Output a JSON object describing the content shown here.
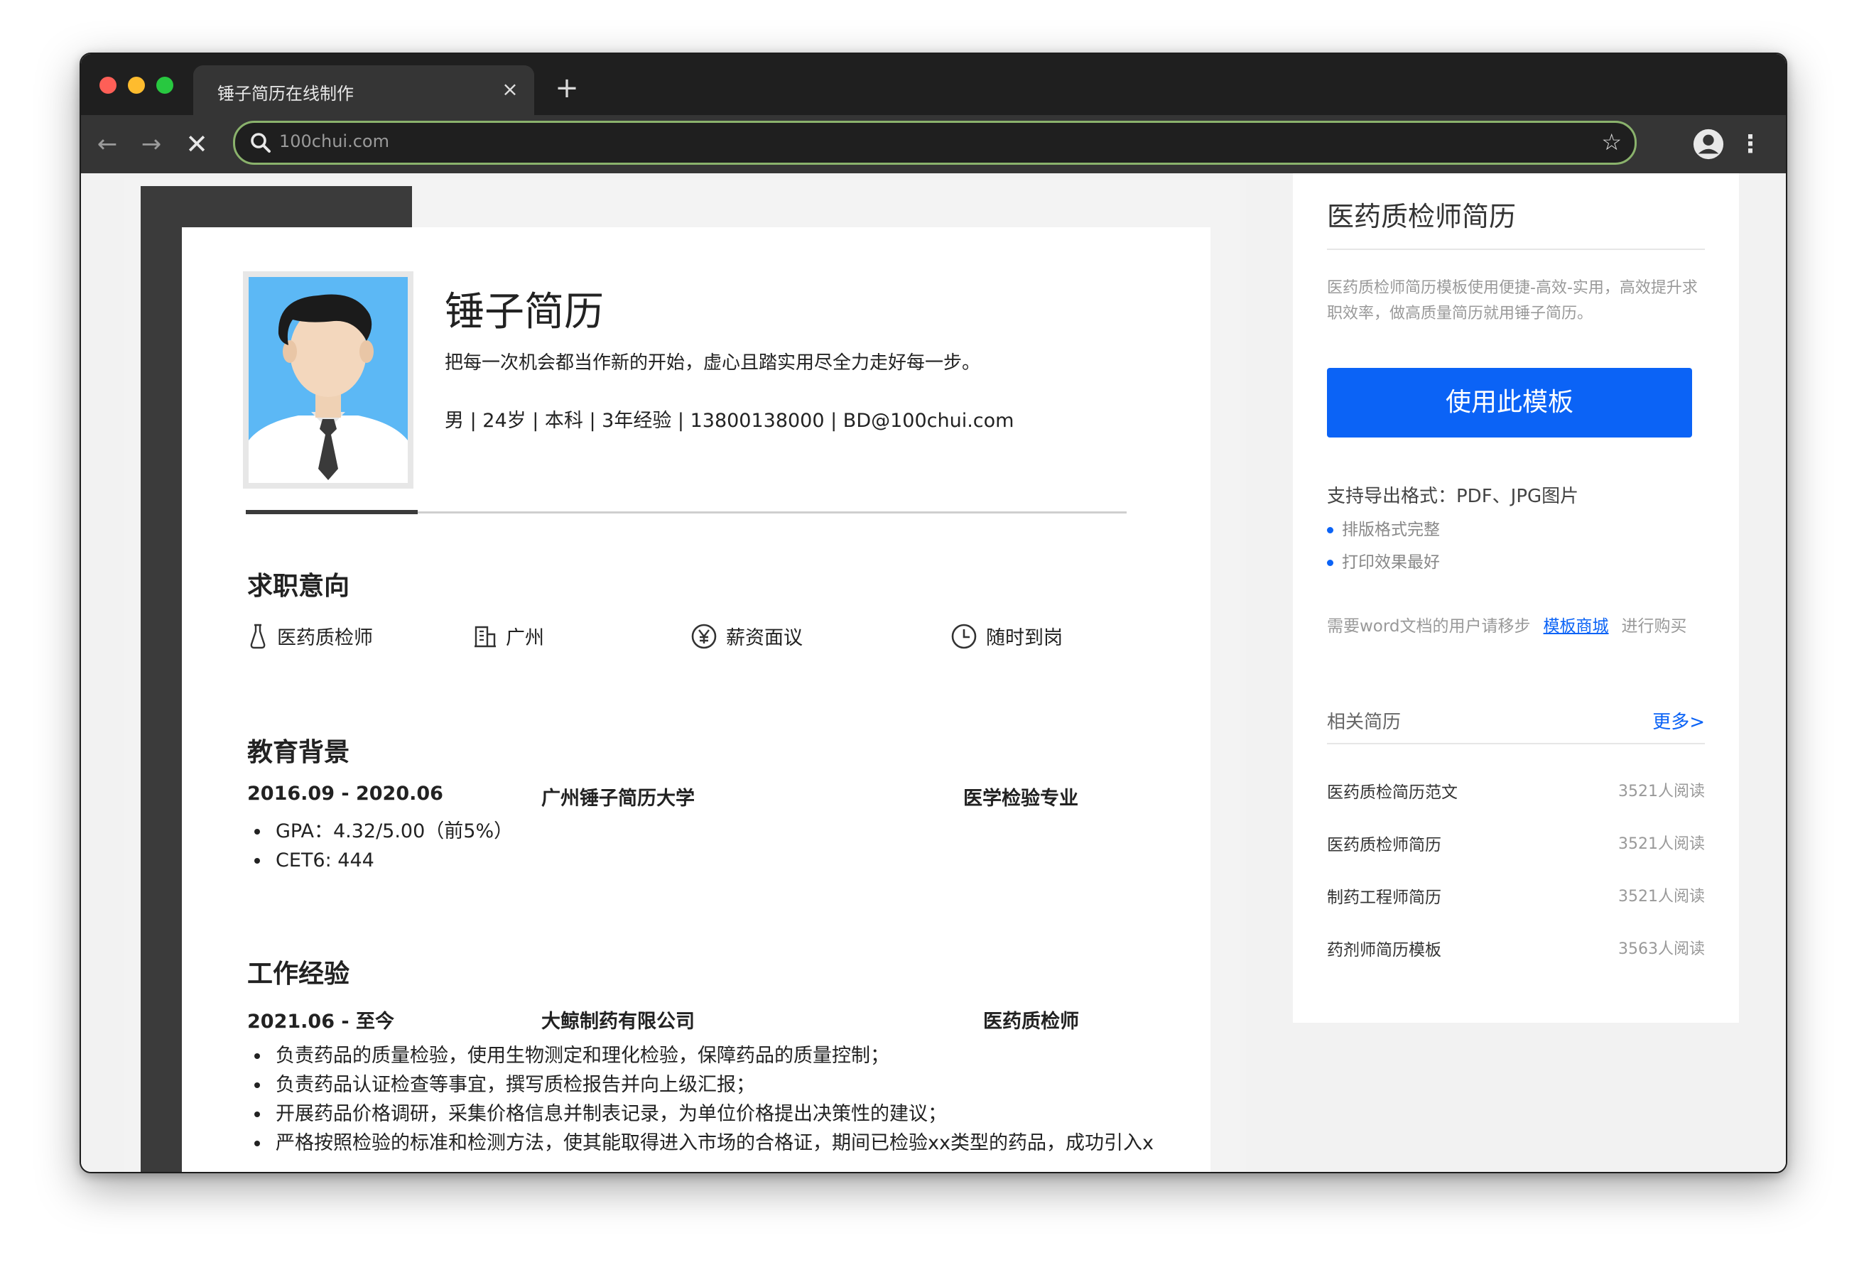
{
  "browser": {
    "tab_title": "锤子简历在线制作",
    "tab_close": "×",
    "new_tab": "+",
    "url": "100chui.com",
    "back": "←",
    "forward": "→",
    "stop": "✕",
    "star": "☆",
    "menu": "⋮"
  },
  "resume": {
    "name": "锤子简历",
    "motto": "把每一次机会都当作新的开始，虚心且踏实用尽全力走好每一步。",
    "info": "男 | 24岁 | 本科 | 3年经验 | 13800138000 | BD@100chui.com",
    "job_intent": {
      "title": "求职意向",
      "position": "医药质检师",
      "city": "广州",
      "salary": "薪资面议",
      "availability": "随时到岗"
    },
    "education": {
      "title": "教育背景",
      "period": "2016.09 - 2020.06",
      "school": "广州锤子简历大学",
      "major": "医学检验专业",
      "items": [
        "GPA：4.32/5.00（前5%）",
        "CET6: 444"
      ]
    },
    "work": {
      "title": "工作经验",
      "period": "2021.06 - 至今",
      "company": "大鲸制药有限公司",
      "role": "医药质检师",
      "items": [
        "负责药品的质量检验，使用生物测定和理化检验，保障药品的质量控制；",
        "负责药品认证检查等事宜，撰写质检报告并向上级汇报；",
        "开展药品价格调研，采集价格信息并制表记录，为单位价格提出决策性的建议；",
        "严格按照检验的标准和检测方法，使其能取得进入市场的合格证，期间已检验xx类型的药品，成功引入x"
      ]
    }
  },
  "sidebar": {
    "title": "医药质检师简历",
    "description": "医药质检师简历模板使用便捷-高效-实用，高效提升求职效率，做高质量简历就用锤子简历。",
    "use_button": "使用此模板",
    "export_formats": "支持导出格式：PDF、JPG图片",
    "features": [
      "排版格式完整",
      "打印效果最好"
    ],
    "note_prefix": "需要word文档的用户请移步",
    "note_link": "模板商城",
    "note_suffix": "进行购买",
    "related_title": "相关简历",
    "more": "更多>",
    "related": [
      {
        "name": "医药质检简历范文",
        "count": "3521人阅读"
      },
      {
        "name": "医药质检师简历",
        "count": "3521人阅读"
      },
      {
        "name": "制药工程师简历",
        "count": "3521人阅读"
      },
      {
        "name": "药剂师简历模板",
        "count": "3563人阅读"
      }
    ]
  },
  "colors": {
    "accent": "#0b63f6",
    "dark_block": "#3b3b3b",
    "photo_bg": "#5cb8f5"
  }
}
